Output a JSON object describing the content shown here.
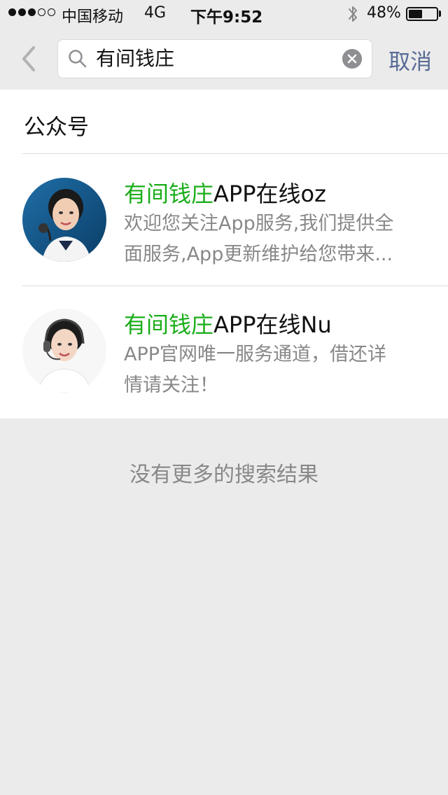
{
  "status_bar": {
    "carrier": "中国移动",
    "network": "4G",
    "time": "下午9:52",
    "battery_percent": "48%",
    "battery_level": 0.48,
    "signal_bars_filled": 3,
    "signal_bars_total": 5
  },
  "search": {
    "query": "有间钱庄",
    "cancel_label": "取消"
  },
  "section": {
    "title": "公众号"
  },
  "results": [
    {
      "title_highlight": "有间钱庄",
      "title_rest": "APP在线oz",
      "desc_line1": "欢迎您关注App服务,我们提供全",
      "desc_line2": "面服务,App更新维护给您带来...",
      "avatar_icon": "customer-service-woman-avatar"
    },
    {
      "title_highlight": "有间钱庄",
      "title_rest": "APP在线Nu",
      "desc_line1": "APP官网唯一服务通道，借还详",
      "desc_line2": "情请关注！",
      "avatar_icon": "customer-service-woman-headset-avatar"
    }
  ],
  "footer": {
    "no_more": "没有更多的搜索结果"
  },
  "colors": {
    "highlight": "#1aad19",
    "link": "#576b95",
    "background": "#ebebeb"
  }
}
